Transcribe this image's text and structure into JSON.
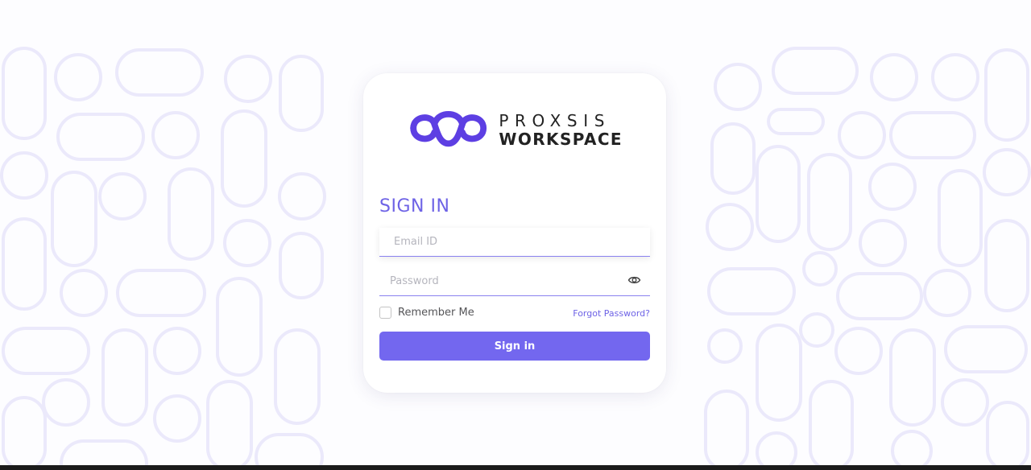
{
  "brand": {
    "logo_line1": "PROXSIS",
    "logo_line2": "WORKSPACE",
    "logo_icon": "infinity-knot-icon",
    "accent_color": "#6e63e6",
    "button_color": "#7367ef"
  },
  "form": {
    "title": "SIGN IN",
    "email": {
      "value": "",
      "placeholder": "Email ID"
    },
    "password": {
      "value": "",
      "placeholder": "Password",
      "toggle_icon": "eye-icon"
    },
    "remember_label": "Remember Me",
    "remember_checked": false,
    "forgot_label": "Forgot Password?",
    "submit_label": "Sign in"
  }
}
